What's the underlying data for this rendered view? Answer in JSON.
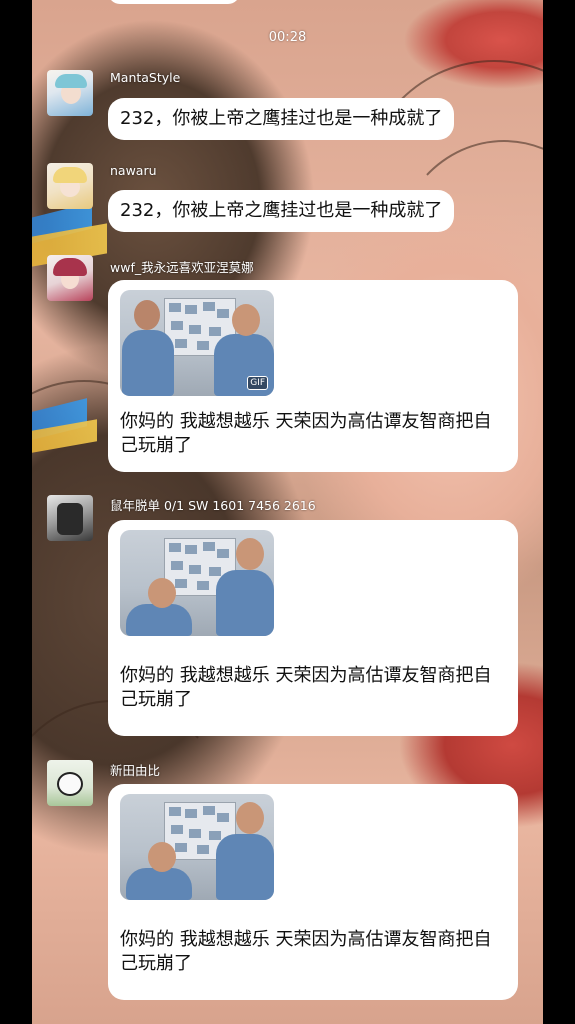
{
  "status": {
    "time": "00:28"
  },
  "messages": [
    {
      "user": "MantaStyle",
      "avatar": "anime-girl-blue-hair-avatar",
      "text": "232，你被上帝之鹰挂过也是一种成就了"
    },
    {
      "user": "nawaru",
      "avatar": "anime-girl-blonde-avatar",
      "text": "232，你被上帝之鹰挂过也是一种成就了"
    },
    {
      "user": "wwf_我永远喜欢亚涅莫娜",
      "avatar": "anime-girl-red-hair-avatar",
      "image": "police-officers-gif",
      "image_badge": "GIF",
      "text": "你妈的 我越想越乐 天荣因为高估谭友智商把自己玩崩了"
    },
    {
      "user": "鼠年脱单 0/1 SW 1601 7456 2616",
      "avatar": "dark-armored-character-avatar",
      "image": "police-officers-laughing",
      "text": "你妈的 我越想越乐 天荣因为高估谭友智商把自己玩崩了"
    },
    {
      "user": "新田由比",
      "avatar": "panda-avatar",
      "image": "police-officers-laughing",
      "text": "你妈的 我越想越乐 天荣因为高估谭友智商把自己玩崩了"
    }
  ]
}
